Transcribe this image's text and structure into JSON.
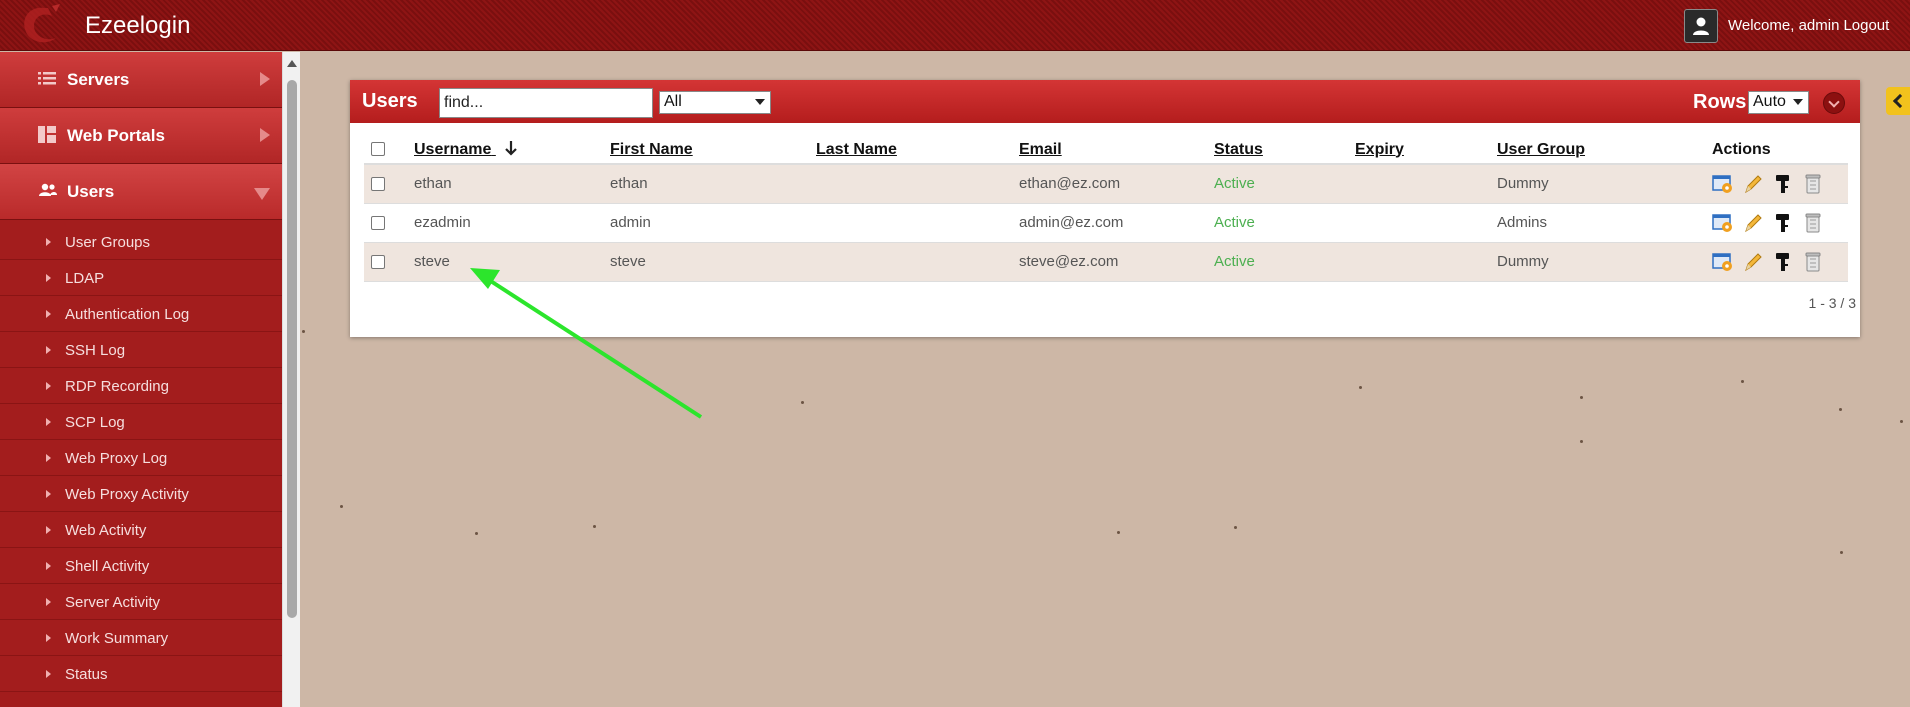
{
  "app": {
    "brand": "Ezeelogin",
    "welcome": "Welcome, admin",
    "logout": "Logout"
  },
  "sidebar": {
    "main": [
      {
        "label": "Servers",
        "icon": "list-icon",
        "open": false
      },
      {
        "label": "Web Portals",
        "icon": "dashboard-icon",
        "open": false
      },
      {
        "label": "Users",
        "icon": "users-icon",
        "open": true
      }
    ],
    "sub": [
      {
        "label": "User Groups"
      },
      {
        "label": "LDAP"
      },
      {
        "label": "Authentication Log"
      },
      {
        "label": "SSH Log"
      },
      {
        "label": "RDP Recording"
      },
      {
        "label": "SCP Log"
      },
      {
        "label": "Web Proxy Log"
      },
      {
        "label": "Web Proxy Activity"
      },
      {
        "label": "Web Activity"
      },
      {
        "label": "Shell Activity"
      },
      {
        "label": "Server Activity"
      },
      {
        "label": "Work Summary"
      },
      {
        "label": "Status"
      }
    ]
  },
  "panel": {
    "title": "Users",
    "search_value": "find...",
    "filter_value": "All",
    "rows_label": "Rows",
    "rows_value": "Auto",
    "pagination": "1 - 3 / 3"
  },
  "table": {
    "headers": {
      "username": "Username",
      "first_name": "First Name",
      "last_name": "Last Name",
      "email": "Email",
      "status": "Status",
      "expiry": "Expiry",
      "user_group": "User Group",
      "actions": "Actions"
    },
    "rows": [
      {
        "username": "ethan",
        "first_name": "ethan",
        "last_name": "",
        "email": "ethan@ez.com",
        "status": "Active",
        "expiry": "",
        "user_group": "Dummy"
      },
      {
        "username": "ezadmin",
        "first_name": "admin",
        "last_name": "",
        "email": "admin@ez.com",
        "status": "Active",
        "expiry": "",
        "user_group": "Admins"
      },
      {
        "username": "steve",
        "first_name": "steve",
        "last_name": "",
        "email": "steve@ez.com",
        "status": "Active",
        "expiry": "",
        "user_group": "Dummy"
      }
    ]
  },
  "colors": {
    "header_red": "#8e1414",
    "sidebar_red": "#a21c1c",
    "status_active": "#4caf50",
    "annotation_arrow": "#2ce52c",
    "page_bg": "#cdb7a6"
  }
}
